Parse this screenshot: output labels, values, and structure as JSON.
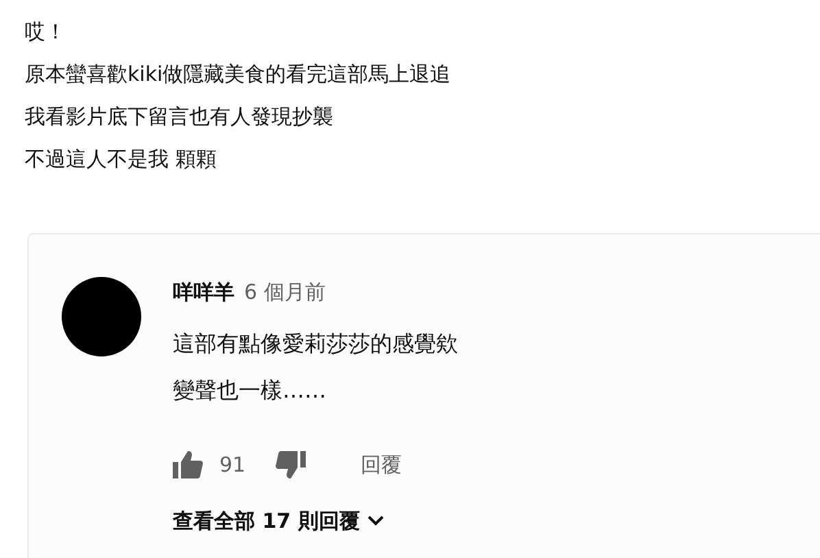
{
  "post": {
    "lines": [
      "哎！",
      "原本蠻喜歡kiki做隱藏美食的看完這部馬上退追",
      "我看影片底下留言也有人發現抄襲",
      "不過這人不是我 顆顆"
    ]
  },
  "comment": {
    "author": "咩咩羊",
    "time": "6 個月前",
    "lines": [
      "這部有點像愛莉莎莎的感覺欸",
      "變聲也一樣……"
    ],
    "likes": "91",
    "reply_label": "回覆",
    "view_replies": "查看全部 17 則回覆"
  }
}
